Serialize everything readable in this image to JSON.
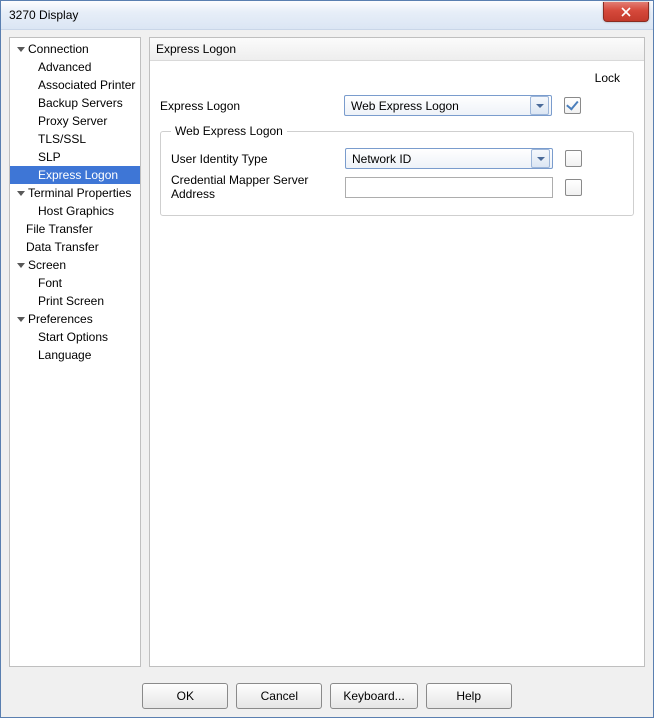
{
  "window": {
    "title": "3270 Display"
  },
  "sidebar": {
    "groups": [
      {
        "label": "Connection",
        "items": [
          "Advanced",
          "Associated Printer",
          "Backup Servers",
          "Proxy Server",
          "TLS/SSL",
          "SLP",
          "Express Logon"
        ],
        "selected_index": 6
      },
      {
        "label": "Terminal Properties",
        "items": [
          "Host Graphics"
        ]
      },
      {
        "label": "File Transfer",
        "items": []
      },
      {
        "label": "Data Transfer",
        "items": []
      },
      {
        "label": "Screen",
        "items": [
          "Font",
          "Print Screen"
        ]
      },
      {
        "label": "Preferences",
        "items": [
          "Start Options",
          "Language"
        ]
      }
    ]
  },
  "main": {
    "header": "Express Logon",
    "lock_label": "Lock",
    "express_logon": {
      "label": "Express Logon",
      "value": "Web Express Logon",
      "locked": true
    },
    "web_group": {
      "legend": "Web Express Logon",
      "identity": {
        "label": "User Identity Type",
        "value": "Network ID",
        "locked": false
      },
      "mapper": {
        "label": "Credential Mapper Server Address",
        "value": "",
        "locked": false
      }
    }
  },
  "buttons": {
    "ok": "OK",
    "cancel": "Cancel",
    "keyboard": "Keyboard...",
    "help": "Help"
  }
}
